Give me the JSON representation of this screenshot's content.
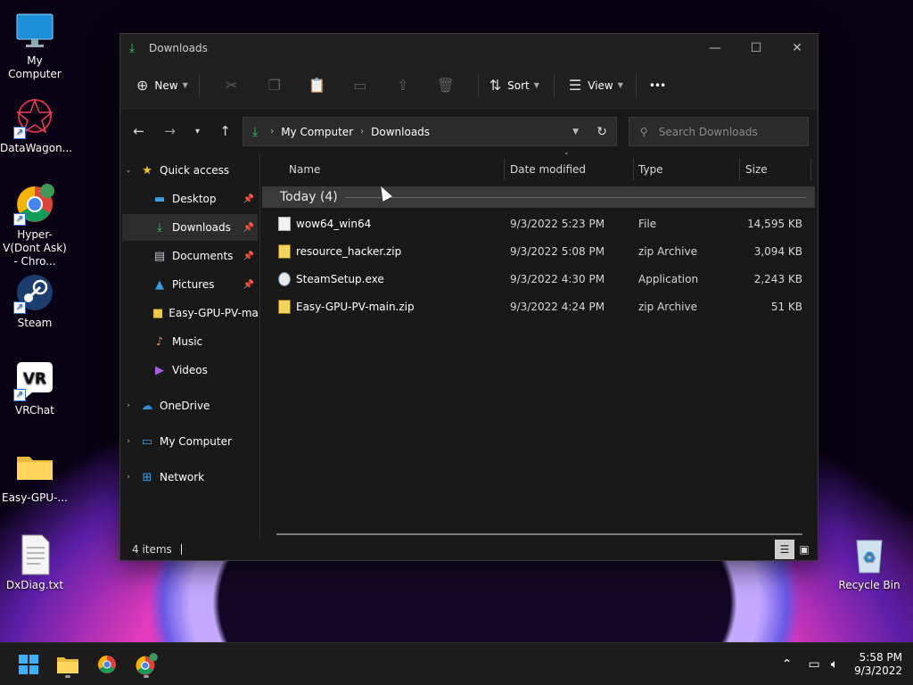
{
  "desktop": {
    "icons": [
      {
        "label": "My Computer",
        "icon": "monitor-icon"
      },
      {
        "label": "DataWagon...",
        "icon": "datawagon-icon"
      },
      {
        "label": "Hyper-V(Dont Ask) - Chro...",
        "icon": "chrome-icon"
      },
      {
        "label": "Steam",
        "icon": "steam-icon"
      },
      {
        "label": "VRChat",
        "icon": "vrchat-icon"
      },
      {
        "label": "Easy-GPU-...",
        "icon": "folder-icon"
      },
      {
        "label": "DxDiag.txt",
        "icon": "text-file-icon"
      },
      {
        "label": "Recycle Bin",
        "icon": "recycle-bin-icon"
      }
    ]
  },
  "window": {
    "title": "Downloads",
    "controls": {
      "minimize": "—",
      "maximize": "☐",
      "close": "✕"
    }
  },
  "toolbar": {
    "new_label": "New",
    "sort_label": "Sort",
    "view_label": "View",
    "more_label": "•••"
  },
  "navbar": {
    "breadcrumbs": [
      "My Computer",
      "Downloads"
    ],
    "search_placeholder": "Search Downloads"
  },
  "sidebar": {
    "quick_access": "Quick access",
    "items": [
      {
        "label": "Desktop",
        "pinned": true
      },
      {
        "label": "Downloads",
        "pinned": true,
        "selected": true
      },
      {
        "label": "Documents",
        "pinned": true
      },
      {
        "label": "Pictures",
        "pinned": true
      },
      {
        "label": "Easy-GPU-PV-main",
        "pinned": false
      },
      {
        "label": "Music",
        "pinned": false
      },
      {
        "label": "Videos",
        "pinned": false
      }
    ],
    "onedrive": "OneDrive",
    "my_computer": "My Computer",
    "network": "Network"
  },
  "columns": {
    "name": "Name",
    "date": "Date modified",
    "type": "Type",
    "size": "Size"
  },
  "group": {
    "label": "Today (4)"
  },
  "files": [
    {
      "name": "wow64_win64",
      "date": "9/3/2022 5:23 PM",
      "type": "File",
      "size": "14,595 KB"
    },
    {
      "name": "resource_hacker.zip",
      "date": "9/3/2022 5:08 PM",
      "type": "zip Archive",
      "size": "3,094 KB"
    },
    {
      "name": "SteamSetup.exe",
      "date": "9/3/2022 4:30 PM",
      "type": "Application",
      "size": "2,243 KB"
    },
    {
      "name": "Easy-GPU-PV-main.zip",
      "date": "9/3/2022 4:24 PM",
      "type": "zip Archive",
      "size": "51 KB"
    }
  ],
  "status": {
    "items": "4 items"
  },
  "taskbar": {
    "time": "5:58 PM",
    "date": "9/3/2022"
  },
  "colors": {
    "accent_green": "#36c26a",
    "window_bg": "#191919",
    "toolbar_bg": "#202020"
  }
}
